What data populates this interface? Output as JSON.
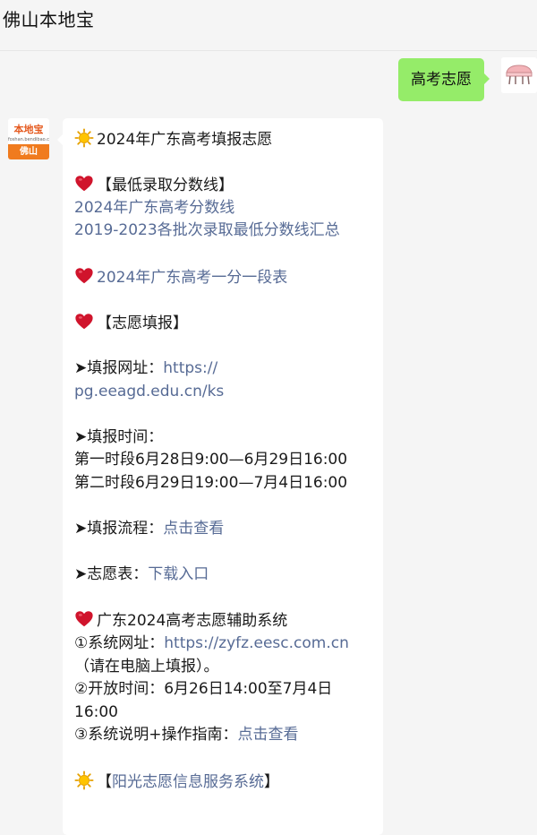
{
  "header": {
    "title": "佛山本地宝"
  },
  "outgoing": {
    "text": "高考志愿"
  },
  "account": {
    "avatar_brand": "本地宝",
    "avatar_site": "foshan.bendibao.com",
    "avatar_city": "佛山"
  },
  "message": {
    "title": "2024年广东高考填报志愿",
    "score_section": {
      "heading": "【最低录取分数线】",
      "link1": "2024年广东高考分数线",
      "link2": "2019-2023各批次录取最低分数线汇总"
    },
    "yifen_link": "2024年广东高考一分一段表",
    "fill_heading": "【志愿填报】",
    "site": {
      "label": "➤填报网址：",
      "url_part1": "https://",
      "url_part2": "pg.eeagd.edu.cn/ks"
    },
    "time": {
      "label": "➤填报时间：",
      "line1": "第一时段6月28日9:00—6月29日16:00",
      "line2": "第二时段6月29日19:00—7月4日16:00"
    },
    "process": {
      "label": "➤填报流程：",
      "link": "点击查看"
    },
    "form": {
      "label": "➤志愿表：",
      "link": "下载入口"
    },
    "assist": {
      "heading": "广东2024高考志愿辅助系统",
      "item1_label": "①系统网址：",
      "item1_url": "https://zyfz.eesc.com.cn",
      "item1_note": "（请在电脑上填报）。",
      "item2_label": "②开放时间：6月26日14:00至7月4日",
      "item2_cont": "16:00",
      "item3_label": "③系统说明+操作指南：",
      "item3_link": "点击查看"
    },
    "sunshine": {
      "bracket_open": "【",
      "link": "阳光志愿信息服务系统",
      "bracket_close": "】"
    }
  },
  "icons": {
    "sun": "sun-emoji-icon",
    "heart": "red-heart-emoji-icon"
  },
  "colors": {
    "link": "#576b95",
    "bubble_out": "#95ec69",
    "bubble_in": "#ffffff",
    "background": "#f5f5f5"
  }
}
